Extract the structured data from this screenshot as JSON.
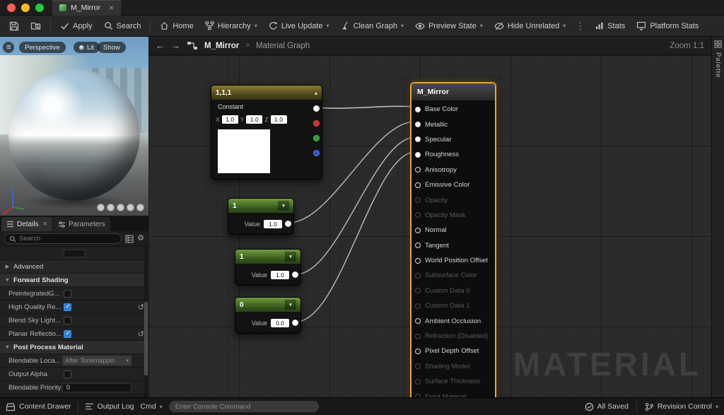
{
  "titlebar": {
    "tab": "M_Mirror"
  },
  "icons": {
    "close": "×",
    "caret_down": "▾",
    "collapse_up": "▴",
    "kebab": "⋮",
    "back": "←",
    "forward": "→",
    "section_open": "▼",
    "section_closed": "▶",
    "gear": "⚙",
    "hamburger": "≡"
  },
  "colors": {
    "selection_accent": "#f0a030",
    "wire": "#c0c0c0",
    "traffic_red": "#ff5f57",
    "traffic_yellow": "#febc2e",
    "traffic_green": "#28c840",
    "pin_red": "#c23030",
    "pin_green": "#2f9a2f",
    "pin_blue": "#3450c8",
    "checkbox_checked": "#2e7fd6"
  },
  "toolbar": {
    "apply": "Apply",
    "search": "Search",
    "home": "Home",
    "hierarchy": "Hierarchy",
    "live_update": "Live Update",
    "clean_graph": "Clean Graph",
    "preview_state": "Preview State",
    "hide_unrelated": "Hide Unrelated",
    "stats": "Stats",
    "platform_stats": "Platform Stats"
  },
  "viewport": {
    "perspective": "Perspective",
    "lit": "Lit",
    "show": "Show",
    "axis_z": "Z",
    "axis_x": "X"
  },
  "details": {
    "tab_details": "Details",
    "tab_parameters": "Parameters",
    "search_placeholder": "Search",
    "advanced": "Advanced",
    "forward_shading": "Forward Shading",
    "forward_rows": [
      {
        "label": "PreintegratedG...",
        "checked": false,
        "reset": false
      },
      {
        "label": "High Quality Re...",
        "checked": true,
        "reset": true
      },
      {
        "label": "Blend Sky Light...",
        "checked": false,
        "reset": false
      },
      {
        "label": "Planar Reflectio...",
        "checked": true,
        "reset": true
      }
    ],
    "post_process": "Post Process Material",
    "blendable_location_label": "Blendable Loca...",
    "blendable_location_value": "After Tonemappin",
    "output_alpha_label": "Output Alpha",
    "blendable_priority_label": "Blendable Priority",
    "blendable_priority_value": "0"
  },
  "graph": {
    "breadcrumb_root": "M_Mirror",
    "breadcrumb_sep": ">",
    "breadcrumb_current": "Material Graph",
    "zoom": "Zoom 1:1",
    "palette": "Palette",
    "watermark": "MATERIAL"
  },
  "nodes": {
    "constant3": {
      "title": "1,1,1",
      "type_label": "Constant",
      "x_label": "X",
      "x_value": "1.0",
      "y_label": "Y",
      "y_value": "1.0",
      "z_label": "Z",
      "z_value": "1.0"
    },
    "const_a": {
      "title": "1",
      "value_label": "Value",
      "value": "1.0"
    },
    "const_b": {
      "title": "1",
      "value_label": "Value",
      "value": "1.0"
    },
    "const_c": {
      "title": "0",
      "value_label": "Value",
      "value": "0.0"
    },
    "material": {
      "title": "M_Mirror",
      "pins": [
        {
          "label": "Base Color",
          "disabled": false,
          "filled": true
        },
        {
          "label": "Metallic",
          "disabled": false,
          "filled": true
        },
        {
          "label": "Specular",
          "disabled": false,
          "filled": true
        },
        {
          "label": "Roughness",
          "disabled": false,
          "filled": true
        },
        {
          "label": "Anisotropy",
          "disabled": false,
          "filled": false
        },
        {
          "label": "Emissive Color",
          "disabled": false,
          "filled": false
        },
        {
          "label": "Opacity",
          "disabled": true,
          "filled": false
        },
        {
          "label": "Opacity Mask",
          "disabled": true,
          "filled": false
        },
        {
          "label": "Normal",
          "disabled": false,
          "filled": false
        },
        {
          "label": "Tangent",
          "disabled": false,
          "filled": false
        },
        {
          "label": "World Position Offset",
          "disabled": false,
          "filled": false
        },
        {
          "label": "Subsurface Color",
          "disabled": true,
          "filled": false
        },
        {
          "label": "Custom Data 0",
          "disabled": true,
          "filled": false
        },
        {
          "label": "Custom Data 1",
          "disabled": true,
          "filled": false
        },
        {
          "label": "Ambient Occlusion",
          "disabled": false,
          "filled": false
        },
        {
          "label": "Refraction (Disabled)",
          "disabled": true,
          "filled": false
        },
        {
          "label": "Pixel Depth Offset",
          "disabled": false,
          "filled": false
        },
        {
          "label": "Shading Model",
          "disabled": true,
          "filled": false
        },
        {
          "label": "Surface Thickness",
          "disabled": true,
          "filled": false
        },
        {
          "label": "Front Material",
          "disabled": true,
          "filled": false
        }
      ]
    }
  },
  "statusbar": {
    "content_drawer": "Content Drawer",
    "output_log": "Output Log",
    "cmd": "Cmd",
    "console_placeholder": "Enter Console Command",
    "all_saved": "All Saved",
    "revision_control": "Revision Control"
  }
}
